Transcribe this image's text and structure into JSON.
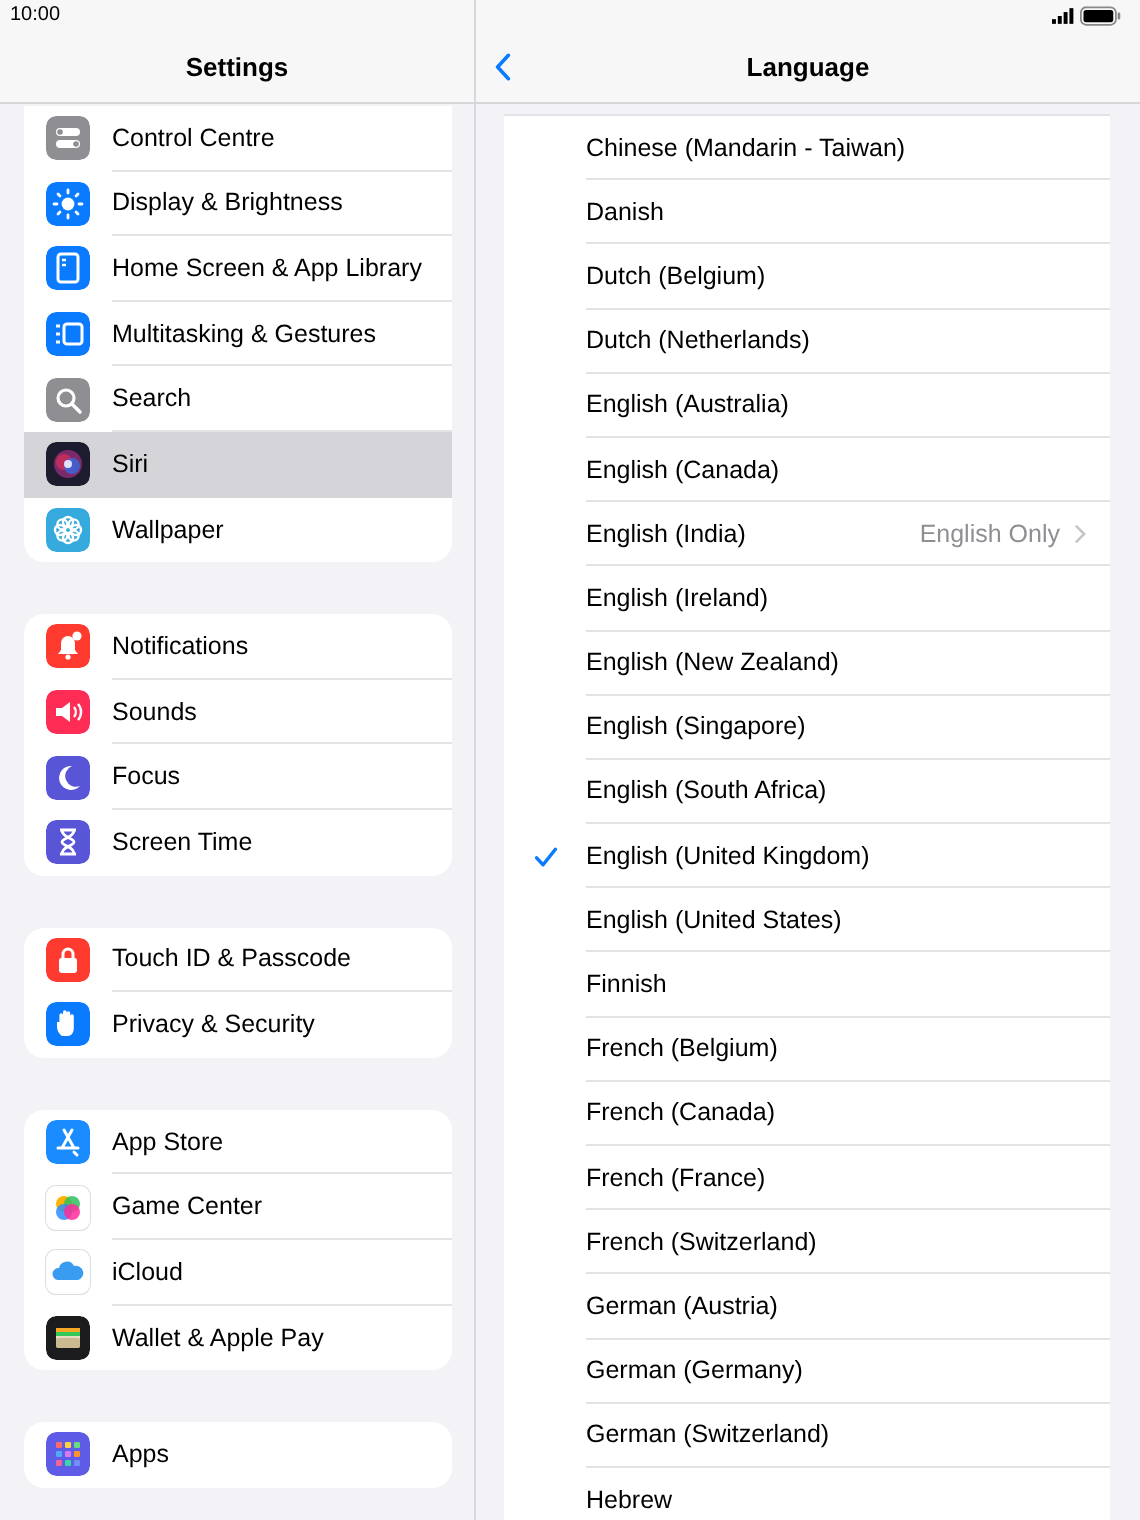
{
  "status_bar": {
    "time": "10:00"
  },
  "sidebar": {
    "title": "Settings",
    "groups": [
      {
        "items": [
          {
            "label": "Control Centre",
            "selected": false
          },
          {
            "label": "Display & Brightness",
            "selected": false
          },
          {
            "label": "Home Screen & App Library",
            "selected": false
          },
          {
            "label": "Multitasking & Gestures",
            "selected": false
          },
          {
            "label": "Search",
            "selected": false
          },
          {
            "label": "Siri",
            "selected": true
          },
          {
            "label": "Wallpaper",
            "selected": false
          }
        ]
      },
      {
        "items": [
          {
            "label": "Notifications",
            "selected": false
          },
          {
            "label": "Sounds",
            "selected": false
          },
          {
            "label": "Focus",
            "selected": false
          },
          {
            "label": "Screen Time",
            "selected": false
          }
        ]
      },
      {
        "items": [
          {
            "label": "Touch ID & Passcode",
            "selected": false
          },
          {
            "label": "Privacy & Security",
            "selected": false
          }
        ]
      },
      {
        "items": [
          {
            "label": "App Store",
            "selected": false
          },
          {
            "label": "Game Center",
            "selected": false
          },
          {
            "label": "iCloud",
            "selected": false
          },
          {
            "label": "Wallet & Apple Pay",
            "selected": false
          }
        ]
      },
      {
        "items": [
          {
            "label": "Apps",
            "selected": false
          }
        ]
      }
    ]
  },
  "detail": {
    "title": "Language",
    "languages": [
      {
        "label": "Chinese (Mandarin - Taiwan)",
        "checked": false
      },
      {
        "label": "Danish",
        "checked": false
      },
      {
        "label": "Dutch (Belgium)",
        "checked": false
      },
      {
        "label": "Dutch (Netherlands)",
        "checked": false
      },
      {
        "label": "English (Australia)",
        "checked": false
      },
      {
        "label": "English (Canada)",
        "checked": false
      },
      {
        "label": "English (India)",
        "checked": false,
        "detail": "English Only"
      },
      {
        "label": "English (Ireland)",
        "checked": false
      },
      {
        "label": "English (New Zealand)",
        "checked": false
      },
      {
        "label": "English (Singapore)",
        "checked": false
      },
      {
        "label": "English (South Africa)",
        "checked": false
      },
      {
        "label": "English (United Kingdom)",
        "checked": true
      },
      {
        "label": "English (United States)",
        "checked": false
      },
      {
        "label": "Finnish",
        "checked": false
      },
      {
        "label": "French (Belgium)",
        "checked": false
      },
      {
        "label": "French (Canada)",
        "checked": false
      },
      {
        "label": "French (France)",
        "checked": false
      },
      {
        "label": "French (Switzerland)",
        "checked": false
      },
      {
        "label": "German (Austria)",
        "checked": false
      },
      {
        "label": "German (Germany)",
        "checked": false
      },
      {
        "label": "German (Switzerland)",
        "checked": false
      },
      {
        "label": "Hebrew",
        "checked": false
      }
    ]
  }
}
